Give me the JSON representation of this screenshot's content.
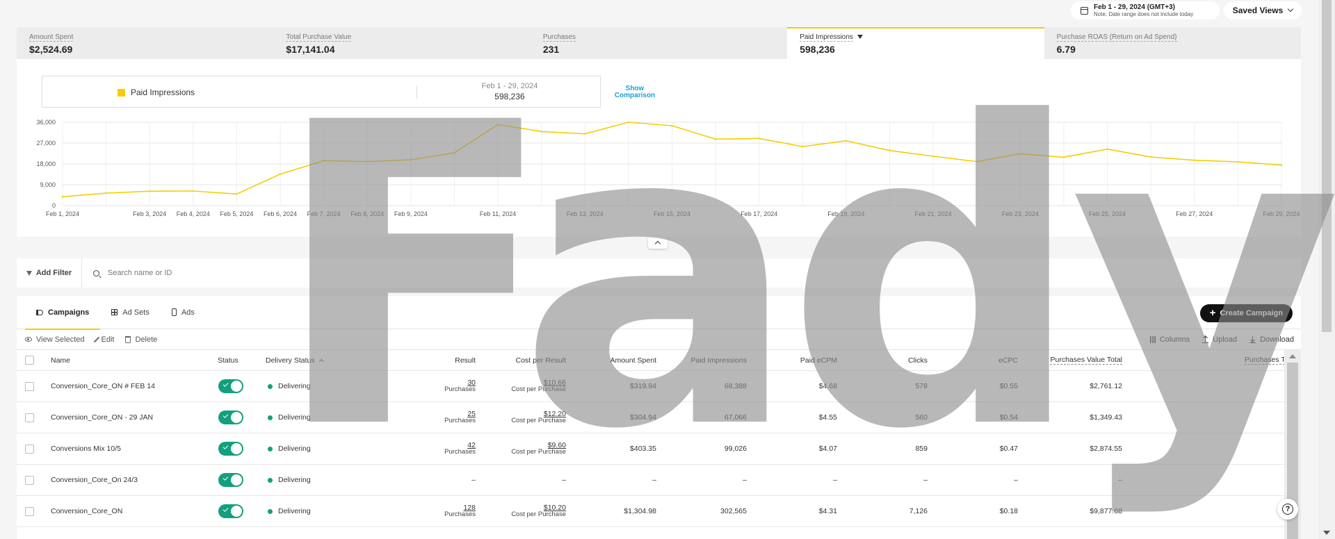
{
  "toolbar": {
    "date_range": "Feb 1 - 29, 2024 (GMT+3)",
    "date_note": "Note: Date range does not include today",
    "saved_views": "Saved Views"
  },
  "kpis": [
    {
      "label": "Amount Spent",
      "value": "$2,524.69"
    },
    {
      "label": "Total Purchase Value",
      "value": "$17,141.04"
    },
    {
      "label": "Purchases",
      "value": "231"
    },
    {
      "label": "Paid Impressions",
      "value": "598,236"
    },
    {
      "label": "Purchase ROAS (Return on Ad Spend)",
      "value": "6.79"
    }
  ],
  "legend": {
    "series_name": "Paid Impressions",
    "period": "Feb 1 - 29, 2024",
    "total": "598,236",
    "show_comparison": "Show Comparison"
  },
  "chart_data": {
    "type": "line",
    "ylim": [
      0,
      36000
    ],
    "y_ticks": [
      "36,000",
      "27,000",
      "18,000",
      "9,000",
      "0"
    ],
    "x_labels": [
      "Feb 1, 2024",
      "Feb 3, 2024",
      "Feb 4, 2024",
      "Feb 5, 2024",
      "Feb 6, 2024",
      "Feb 7, 2024",
      "Feb 8, 2024",
      "Feb 9, 2024",
      "Feb 11, 2024",
      "Feb 13, 2024",
      "Feb 15, 2024",
      "Feb 17, 2024",
      "Feb 19, 2024",
      "Feb 21, 2024",
      "Feb 23, 2024",
      "Feb 25, 2024",
      "Feb 27, 2024",
      "Feb 29, 2024"
    ],
    "series": [
      {
        "name": "Paid Impressions",
        "color": "#f5cd00",
        "x": [
          1,
          2,
          3,
          4,
          5,
          6,
          7,
          8,
          9,
          10,
          11,
          12,
          13,
          14,
          15,
          16,
          17,
          18,
          19,
          20,
          21,
          22,
          23,
          24,
          25,
          26,
          27,
          28,
          29
        ],
        "values": [
          3800,
          5400,
          6200,
          6300,
          5000,
          13600,
          19400,
          19000,
          19800,
          22800,
          35000,
          32000,
          31000,
          36000,
          34500,
          28700,
          29000,
          25500,
          28000,
          23800,
          21300,
          19000,
          22400,
          20900,
          24400,
          21000,
          19600,
          18900,
          17500
        ]
      }
    ]
  },
  "filter": {
    "add_filter": "Add Filter",
    "search_placeholder": "Search name or ID"
  },
  "tabs": [
    {
      "label": "Campaigns",
      "icon": "megaphone-icon"
    },
    {
      "label": "Ad Sets",
      "icon": "grid-icon"
    },
    {
      "label": "Ads",
      "icon": "phone-icon"
    }
  ],
  "create_campaign": "Create Campaign",
  "actions": {
    "view_selected": "View Selected",
    "edit": "Edit",
    "delete": "Delete",
    "columns": "Columns",
    "upload": "Upload",
    "download": "Download"
  },
  "columns": {
    "name": "Name",
    "status": "Status",
    "delivery_status": "Delivery Status",
    "result": "Result",
    "cost_per_result": "Cost per Result",
    "amount_spent": "Amount Spent",
    "paid_impressions": "Paid Impressions",
    "paid_ecpm": "Paid eCPM",
    "clicks": "Clicks",
    "ecpc": "eCPC",
    "purchases_value_total": "Purchases Value Total",
    "purchases_total": "Purchases To"
  },
  "rows": [
    {
      "name": "Conversion_Core_ON # FEB 14",
      "delivery": "Delivering",
      "result": "30",
      "result_unit": "Purchases",
      "cpr": "$10.66",
      "cpr_unit": "Cost per Purchase",
      "spent": "$319.94",
      "impr": "68,388",
      "ecpm": "$4.68",
      "clicks": "578",
      "ecpc": "$0.55",
      "pvt": "$2,761.12"
    },
    {
      "name": "Conversion_Core_ON - 29 JAN",
      "delivery": "Delivering",
      "result": "25",
      "result_unit": "Purchases",
      "cpr": "$12.20",
      "cpr_unit": "Cost per Purchase",
      "spent": "$304.94",
      "impr": "67,066",
      "ecpm": "$4.55",
      "clicks": "560",
      "ecpc": "$0.54",
      "pvt": "$1,349.43"
    },
    {
      "name": "Conversions Mix 10/5",
      "delivery": "Delivering",
      "result": "42",
      "result_unit": "Purchases",
      "cpr": "$9.60",
      "cpr_unit": "Cost per Purchase",
      "spent": "$403.35",
      "impr": "99,026",
      "ecpm": "$4.07",
      "clicks": "859",
      "ecpc": "$0.47",
      "pvt": "$2,874.55"
    },
    {
      "name": "Conversion_Core_On 24/3",
      "delivery": "Delivering",
      "result": "–",
      "result_unit": "",
      "cpr": "–",
      "cpr_unit": "",
      "spent": "–",
      "impr": "–",
      "ecpm": "–",
      "clicks": "–",
      "ecpc": "–",
      "pvt": "–"
    },
    {
      "name": "Conversion_Core_ON",
      "delivery": "Delivering",
      "result": "128",
      "result_unit": "Purchases",
      "cpr": "$10.20",
      "cpr_unit": "Cost per Purchase",
      "spent": "$1,304.98",
      "impr": "302,565",
      "ecpm": "$4.31",
      "clicks": "7,126",
      "ecpc": "$0.18",
      "pvt": "$9,877.68"
    }
  ],
  "watermark": "Fady"
}
